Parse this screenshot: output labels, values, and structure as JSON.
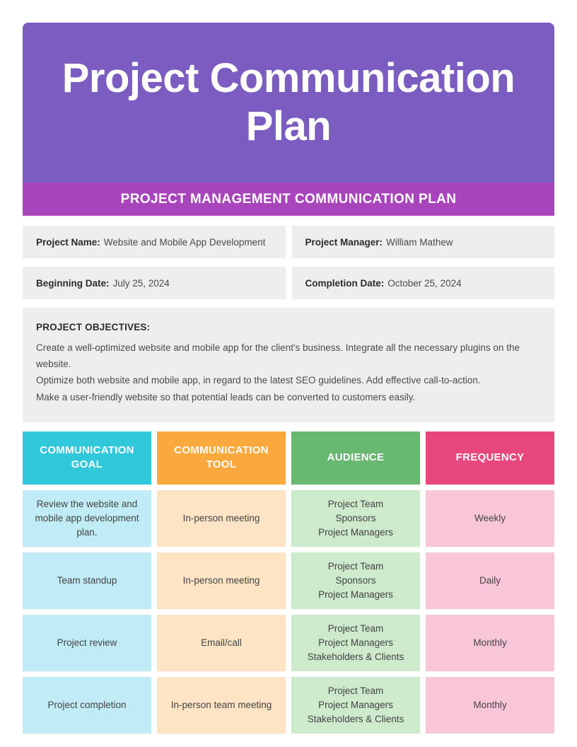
{
  "header": {
    "title": "Project Communication Plan",
    "subtitle": "PROJECT MANAGEMENT COMMUNICATION PLAN",
    "banner_color": "#7b5cc0",
    "subtitle_color": "#a845bd"
  },
  "info": {
    "rows": [
      [
        {
          "label": "Project Name:",
          "value": "Website and Mobile App Development"
        },
        {
          "label": "Project Manager:",
          "value": "William Mathew"
        }
      ],
      [
        {
          "label": "Beginning Date:",
          "value": "July 25, 2024"
        },
        {
          "label": "Completion Date:",
          "value": "October 25, 2024"
        }
      ]
    ]
  },
  "objectives": {
    "title": "PROJECT OBJECTIVES:",
    "lines": [
      "Create a well-optimized website and mobile app for the client's business. Integrate all the necessary plugins on the website.",
      "Optimize both website and mobile app, in regard to the latest SEO guidelines. Add effective call-to-action.",
      "Make a user-friendly website so that potential leads can be converted to customers easily."
    ]
  },
  "matrix": {
    "headers": [
      {
        "label": "COMMUNICATION GOAL",
        "color": "#32c8dc"
      },
      {
        "label": "COMMUNICATION TOOL",
        "color": "#fba93c"
      },
      {
        "label": "AUDIENCE",
        "color": "#68b871"
      },
      {
        "label": "FREQUENCY",
        "color": "#e8477e"
      }
    ],
    "rows": [
      {
        "goal": "Review the website and mobile app development plan.",
        "tool": "In-person meeting",
        "audience": "Project Team\nSponsors\nProject Managers",
        "frequency": "Weekly"
      },
      {
        "goal": "Team standup",
        "tool": "In-person meeting",
        "audience": "Project Team\nSponsors\nProject Managers",
        "frequency": "Daily"
      },
      {
        "goal": "Project review",
        "tool": "Email/call",
        "audience": "Project Team\nProject Managers\nStakeholders & Clients",
        "frequency": "Monthly"
      },
      {
        "goal": "Project completion",
        "tool": "In-person team meeting",
        "audience": "Project Team\nProject Managers\nStakeholders & Clients",
        "frequency": "Monthly"
      }
    ]
  }
}
